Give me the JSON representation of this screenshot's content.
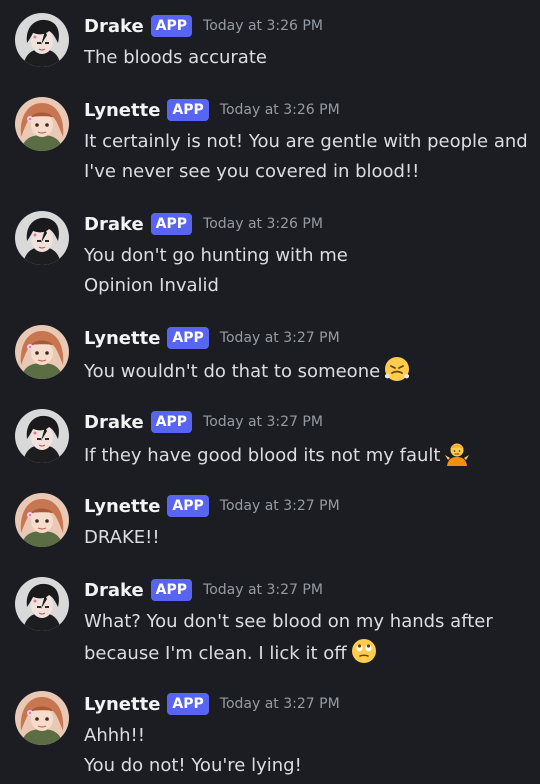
{
  "messages": [
    {
      "author": "Drake",
      "badge": "APP",
      "timestamp": "Today at 3:26 PM",
      "lines": [
        "The bloods accurate"
      ],
      "emoji": null
    },
    {
      "author": "Lynette",
      "badge": "APP",
      "timestamp": "Today at 3:26 PM",
      "lines": [
        "It certainly is not! You are gentle with people and",
        "I've never see you covered in blood!!"
      ],
      "emoji": null
    },
    {
      "author": "Drake",
      "badge": "APP",
      "timestamp": "Today at 3:26 PM",
      "lines": [
        "You don't go hunting with me",
        "Opinion Invalid"
      ],
      "emoji": null
    },
    {
      "author": "Lynette",
      "badge": "APP",
      "timestamp": "Today at 3:27 PM",
      "lines": [
        "You wouldn't do that to someone"
      ],
      "emoji": "face-with-steam-from-nose"
    },
    {
      "author": "Drake",
      "badge": "APP",
      "timestamp": "Today at 3:27 PM",
      "lines": [
        "If they have good blood its not my fault"
      ],
      "emoji": "person-shrugging"
    },
    {
      "author": "Lynette",
      "badge": "APP",
      "timestamp": "Today at 3:27 PM",
      "lines": [
        "DRAKE!!"
      ],
      "emoji": null
    },
    {
      "author": "Drake",
      "badge": "APP",
      "timestamp": "Today at 3:27 PM",
      "lines": [
        "What? You don't see blood on my hands after",
        "because I'm clean. I lick it off"
      ],
      "emoji": "face-with-rolling-eyes"
    },
    {
      "author": "Lynette",
      "badge": "APP",
      "timestamp": "Today at 3:27 PM",
      "lines": [
        "Ahhh!!",
        "You do not! You're lying!"
      ],
      "emoji": null
    }
  ],
  "colors": {
    "background": "#1c1d22",
    "badge": "#5865f2",
    "username": "#f2f3f5",
    "timestamp": "#959ba3",
    "message_text": "#dbdee1"
  }
}
